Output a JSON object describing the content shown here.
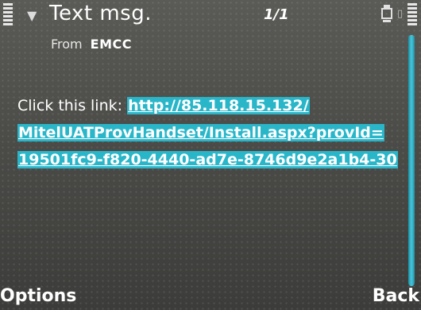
{
  "header": {
    "title": "Text msg.",
    "page_counter": "1/1"
  },
  "from": {
    "label": "From",
    "value": "EMCC"
  },
  "message": {
    "prefix": "Click this link: ",
    "link_lines": [
      "http://85.118.15.132/",
      "MitelUATProvHandset/Install.aspx?provId=",
      "19501fc9-f820-4440-ad7e-8746d9e2a1b4-30"
    ]
  },
  "softkeys": {
    "left": "Options",
    "right": "Back"
  },
  "colors": {
    "link_highlight": "#29b6c9",
    "scrollbar": "#48c6dc",
    "background": "#4a4a47"
  },
  "icons": {
    "signal": "signal-strength-icon",
    "antenna": "antenna-icon",
    "battery": "battery-icon",
    "memory": "memory-card-icon"
  }
}
